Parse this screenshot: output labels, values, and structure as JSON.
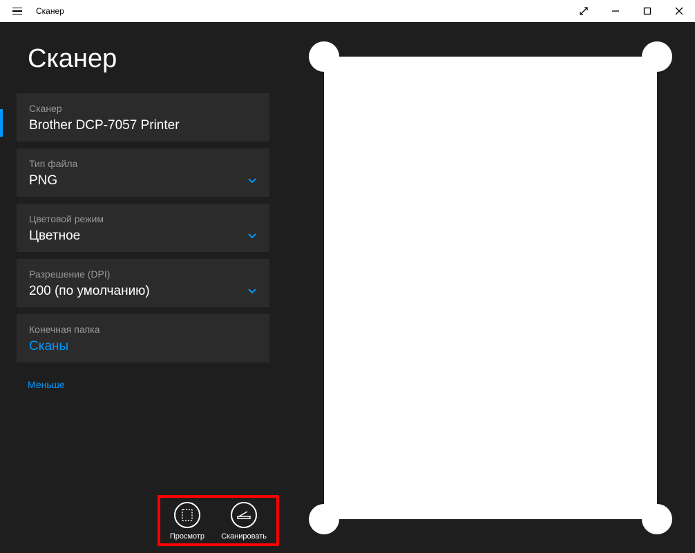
{
  "titlebar": {
    "title": "Сканер"
  },
  "page": {
    "title": "Сканер"
  },
  "settings": {
    "scanner": {
      "label": "Сканер",
      "value": "Brother DCP-7057 Printer"
    },
    "filetype": {
      "label": "Тип файла",
      "value": "PNG"
    },
    "colormode": {
      "label": "Цветовой режим",
      "value": "Цветное"
    },
    "dpi": {
      "label": "Разрешение (DPI)",
      "value": "200 (по умолчанию)"
    },
    "destination": {
      "label": "Конечная папка",
      "value": "Сканы"
    }
  },
  "less_link": "Меньше",
  "actions": {
    "preview": "Просмотр",
    "scan": "Сканировать"
  }
}
